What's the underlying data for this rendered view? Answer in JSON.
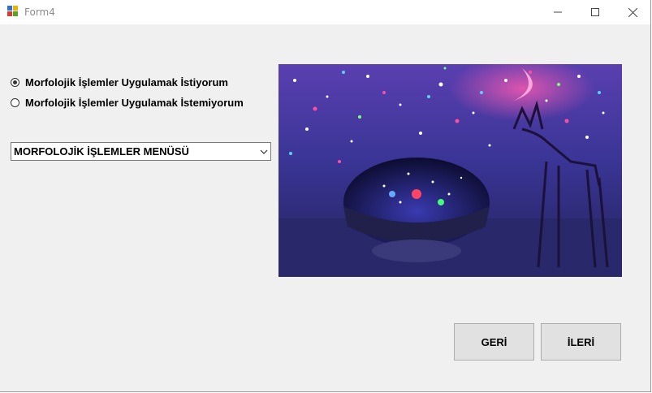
{
  "window": {
    "title": "Form4",
    "icon": "windows-forms-icon",
    "controls": {
      "minimize": "minimize-icon",
      "maximize": "maximize-icon",
      "close": "close-icon"
    }
  },
  "options": [
    {
      "label": "Morfolojik İşlemler Uygulamak İstiyorum",
      "checked": true
    },
    {
      "label": "Morfolojik İşlemler Uygulamak İstemiyorum",
      "checked": false
    }
  ],
  "menu": {
    "selected": "MORFOLOJİK İŞLEMLER MENÜSÜ",
    "icon": "chevron-down-icon"
  },
  "buttons": {
    "back": "GERİ",
    "next": "İLERİ"
  },
  "colors": {
    "window_bg": "#f0f0f0",
    "button_bg": "#e1e1e1",
    "button_border": "#adadad"
  }
}
